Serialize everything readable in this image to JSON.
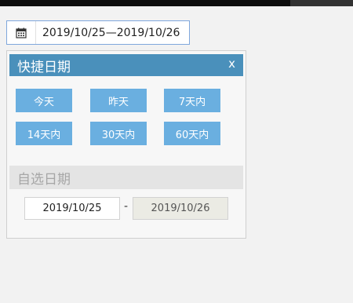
{
  "range_input": {
    "value": "2019/10/25—2019/10/26",
    "icon": "calendar-icon"
  },
  "quick": {
    "title": "快捷日期",
    "close_label": "x",
    "buttons": [
      "今天",
      "昨天",
      "7天内",
      "14天内",
      "30天内",
      "60天内"
    ]
  },
  "custom": {
    "title": "自选日期",
    "start": "2019/10/25",
    "separator": "-",
    "end": "2019/10/26"
  },
  "colors": {
    "header_blue": "#4a90bb",
    "button_blue": "#6aafe0",
    "input_border": "#7fa7dc"
  }
}
